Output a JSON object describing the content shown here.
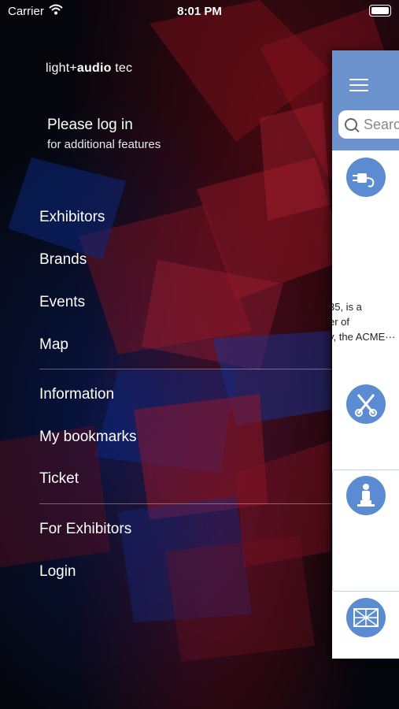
{
  "status_bar": {
    "carrier": "Carrier",
    "time": "8:01 PM"
  },
  "logo": {
    "part1": "light",
    "plus": "+",
    "part2": "audio",
    "part3": "tec"
  },
  "login": {
    "title": "Please log in",
    "subtitle": "for additional features"
  },
  "menu": {
    "group1": [
      "Exhibitors",
      "Brands",
      "Events",
      "Map"
    ],
    "group2": [
      "Information",
      "My bookmarks",
      "Ticket"
    ],
    "group3": [
      "For Exhibitors",
      "Login"
    ]
  },
  "panel": {
    "search_placeholder": "Search",
    "description_lines": [
      "35, is a",
      "er of",
      "y, the ACME···"
    ],
    "icons": [
      "plug-icon",
      "tools-icon",
      "statue-icon",
      "truss-icon"
    ]
  },
  "colors": {
    "panel_header": "#6d93cf",
    "category_icon": "#5b8bd1"
  }
}
